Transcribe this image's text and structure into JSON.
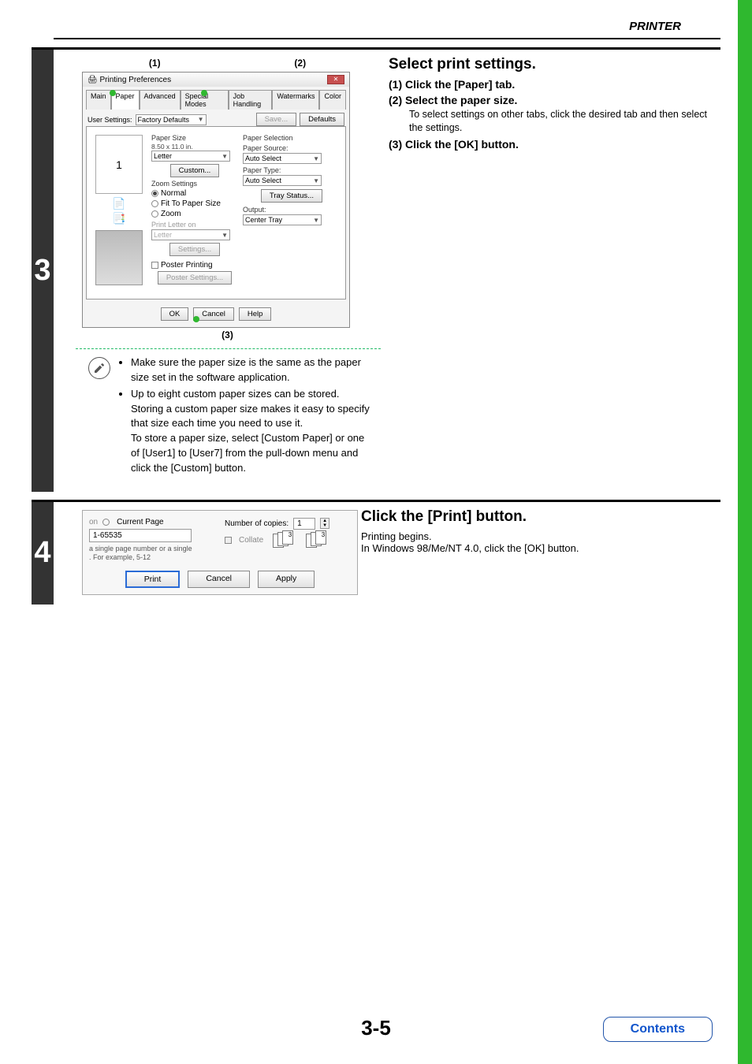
{
  "header": {
    "title": "PRINTER"
  },
  "step3": {
    "number": "3",
    "callout1": "(1)",
    "callout2": "(2)",
    "callout3": "(3)",
    "dialog": {
      "title": "Printing Preferences",
      "tabs": {
        "main": "Main",
        "paper": "Paper",
        "advanced": "Advanced",
        "special": "Special Modes",
        "job": "Job Handling",
        "water": "Watermarks",
        "color": "Color"
      },
      "user_settings_label": "User Settings:",
      "user_settings_value": "Factory Defaults",
      "save_btn": "Save...",
      "defaults_btn": "Defaults",
      "paper_size_label": "Paper Size",
      "paper_size_dim": "8.50 x 11.0 in.",
      "paper_size_value": "Letter",
      "custom_btn": "Custom...",
      "zoom_label": "Zoom Settings",
      "zoom_normal": "Normal",
      "zoom_fit": "Fit To Paper Size",
      "zoom_zoom": "Zoom",
      "print_on_label": "Print Letter on",
      "print_on_value": "Letter",
      "settings_btn": "Settings...",
      "poster_chk": "Poster Printing",
      "poster_btn": "Poster Settings...",
      "paper_selection_label": "Paper Selection",
      "paper_source_label": "Paper Source:",
      "paper_source_value": "Auto Select",
      "paper_type_label": "Paper Type:",
      "paper_type_value": "Auto Select",
      "tray_status_btn": "Tray Status...",
      "output_label": "Output:",
      "output_value": "Center Tray",
      "ok_btn": "OK",
      "cancel_btn": "Cancel",
      "help_btn": "Help",
      "preview_num": "1"
    },
    "instructions": {
      "heading": "Select print settings.",
      "i1": "(1)  Click the [Paper] tab.",
      "i2": "(2)  Select the paper size.",
      "i2_detail": "To select settings on other tabs, click the desired tab and then select the settings.",
      "i3": "(3)  Click the [OK] button."
    },
    "notes": {
      "n1": "Make sure the paper size is the same as the paper size set in the software application.",
      "n2a": "Up to eight custom paper sizes can be stored. Storing a custom paper size makes it easy to specify that size each time you need to use it.",
      "n2b": "To store a paper size, select [Custom Paper] or one of [User1] to [User7] from the pull-down menu and click the [Custom] button."
    }
  },
  "step4": {
    "number": "4",
    "dialog": {
      "current_page": "Current Page",
      "range_value": "1-65535",
      "range_hint1": "a single page number or a single",
      "range_hint2": ".  For example, 5-12",
      "copies_label": "Number of copies:",
      "copies_value": "1",
      "collate_label": "Collate",
      "print_btn": "Print",
      "cancel_btn": "Cancel",
      "apply_btn": "Apply",
      "on_label": "on"
    },
    "instructions": {
      "heading": "Click the [Print] button.",
      "l1": "Printing begins.",
      "l2": "In Windows 98/Me/NT 4.0, click the [OK] button."
    }
  },
  "footer": {
    "page": "3-5",
    "contents": "Contents"
  }
}
